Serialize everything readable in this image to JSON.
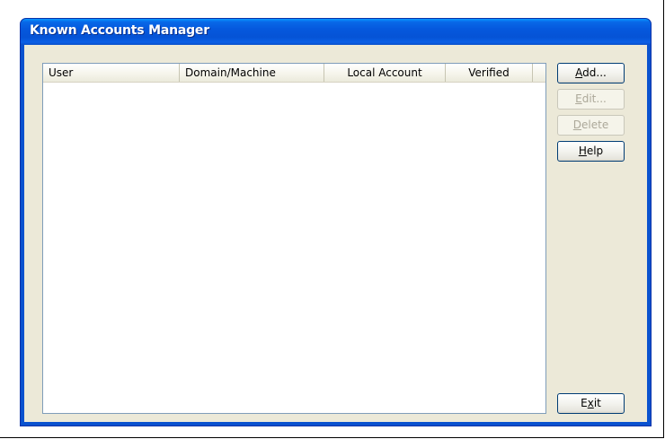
{
  "window": {
    "title": "Known Accounts Manager"
  },
  "list": {
    "columns": [
      "User",
      "Domain/Machine",
      "Local Account",
      "Verified"
    ],
    "rows": []
  },
  "buttons": {
    "add": {
      "mnemonic": "A",
      "rest": "dd...",
      "enabled": true
    },
    "edit": {
      "mnemonic": "E",
      "rest": "dit...",
      "enabled": false
    },
    "delete": {
      "mnemonic": "D",
      "rest": "elete",
      "enabled": false
    },
    "help": {
      "mnemonic": "H",
      "rest": "elp",
      "enabled": true
    },
    "exit": {
      "pre": "E",
      "mnemonic": "x",
      "rest": "it",
      "enabled": true
    }
  },
  "colors": {
    "titlebar": "#0553d6",
    "dialog_face": "#ece9d8",
    "button_border": "#003c74",
    "disabled_text": "#aca899"
  }
}
